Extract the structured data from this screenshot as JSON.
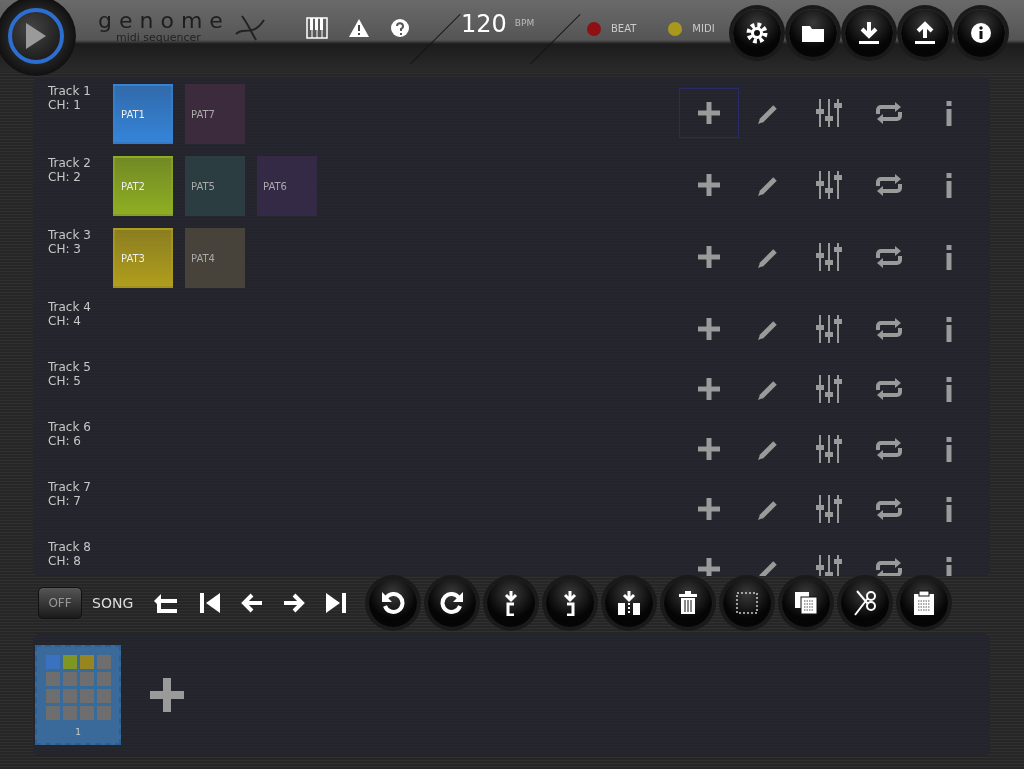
{
  "header": {
    "title": "genome",
    "subtitle": "midi sequencer",
    "bpm": "120",
    "bpm_unit": "BPM",
    "indicators": [
      {
        "label": "BEAT",
        "color": "#8e1014"
      },
      {
        "label": "MIDI",
        "color": "#a8981e"
      }
    ]
  },
  "tracks": [
    {
      "name": "Track 1",
      "channel": "CH: 1",
      "selected": true,
      "patterns": [
        {
          "label": "PAT1",
          "color": "#3584d8",
          "selected": true
        },
        {
          "label": "PAT7",
          "color": "#3b2b3d",
          "selected": false
        }
      ]
    },
    {
      "name": "Track 2",
      "channel": "CH: 2",
      "selected": false,
      "patterns": [
        {
          "label": "PAT2",
          "color": "#8fae22",
          "selected": true
        },
        {
          "label": "PAT5",
          "color": "#2b3d40",
          "selected": false
        },
        {
          "label": "PAT6",
          "color": "#342a45",
          "selected": false
        }
      ]
    },
    {
      "name": "Track 3",
      "channel": "CH: 3",
      "selected": false,
      "patterns": [
        {
          "label": "PAT3",
          "color": "#b09e1c",
          "selected": true
        },
        {
          "label": "PAT4",
          "color": "#47423a",
          "selected": false
        }
      ]
    },
    {
      "name": "Track 4",
      "channel": "CH: 4",
      "selected": false
    },
    {
      "name": "Track 5",
      "channel": "CH: 5",
      "selected": false
    },
    {
      "name": "Track 6",
      "channel": "CH: 6",
      "selected": false
    },
    {
      "name": "Track 7",
      "channel": "CH: 7",
      "selected": false
    },
    {
      "name": "Track 8",
      "channel": "CH: 8",
      "selected": false
    }
  ],
  "song_bar": {
    "switch": {
      "text": "OFF",
      "on": false
    },
    "label": "SONG"
  },
  "song": [
    {
      "label": "1",
      "selected": true,
      "cells": [
        {
          "color": "#3a72c0"
        },
        {
          "color": "#7f9722"
        },
        {
          "color": "#97861f"
        },
        {
          "color": "#6e6e6e"
        },
        {
          "color": "#6e6e6e"
        },
        {
          "color": "#6e6e6e"
        },
        {
          "color": "#6e6e6e"
        },
        {
          "color": "#6e6e6e"
        },
        {
          "color": "#6e6e6e"
        },
        {
          "color": "#6e6e6e"
        },
        {
          "color": "#6e6e6e"
        },
        {
          "color": "#6e6e6e"
        },
        {
          "color": "#6e6e6e"
        },
        {
          "color": "#6e6e6e"
        },
        {
          "color": "#6e6e6e"
        },
        {
          "color": "#6e6e6e"
        }
      ]
    }
  ]
}
